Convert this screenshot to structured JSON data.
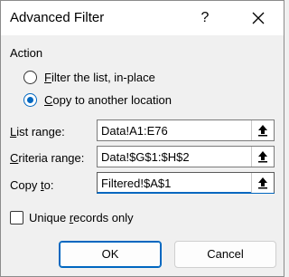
{
  "window": {
    "title": "Advanced Filter",
    "help_label": "?",
    "close_icon": "close-icon"
  },
  "action": {
    "group_label": "Action",
    "options": [
      {
        "label_mn": "F",
        "label_rest": "ilter the list, in-place",
        "selected": false
      },
      {
        "label_mn": "C",
        "label_rest": "opy to another location",
        "selected": true
      }
    ]
  },
  "fields": {
    "list_range": {
      "label_mn": "L",
      "label_rest": "ist range:",
      "value": "Data!A1:E76"
    },
    "criteria_range": {
      "label_mn": "C",
      "label_rest": "riteria range:",
      "value": "Data!$G$1:$H$2"
    },
    "copy_to": {
      "label_pre": "Copy ",
      "label_mn": "t",
      "label_rest": "o:",
      "value": "Filtered!$A$1"
    }
  },
  "unique": {
    "label_pre": "Unique ",
    "label_mn": "r",
    "label_rest": "ecords only",
    "checked": false
  },
  "buttons": {
    "ok": "OK",
    "cancel": "Cancel"
  },
  "colors": {
    "accent": "#0067c0",
    "window_bg": "#f0f0f0",
    "titlebar_bg": "#ffffff"
  }
}
